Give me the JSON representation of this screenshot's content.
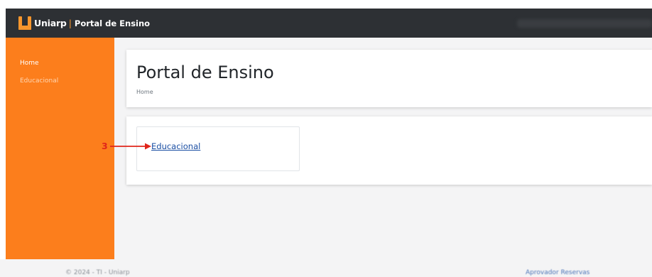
{
  "topbar": {
    "brand_name": "Uniarp",
    "brand_separator": "|",
    "brand_portal": "Portal de Ensino",
    "colors": {
      "background": "#2d3034",
      "logo_orange": "#f7962d"
    }
  },
  "sidebar": {
    "items": [
      {
        "label": "Home",
        "active": true
      },
      {
        "label": "Educacional",
        "active": false
      }
    ],
    "colors": {
      "background": "#fc7e1c"
    }
  },
  "header": {
    "title": "Portal de Ensino",
    "breadcrumb": "Home"
  },
  "main": {
    "tiles": [
      {
        "label": "Educacional"
      }
    ]
  },
  "annotation": {
    "number": "3",
    "color": "#e0261b"
  },
  "footer": {
    "copyright": "© 2024 - TI - Uniarp",
    "link_label": "Aprovador Reservas"
  }
}
